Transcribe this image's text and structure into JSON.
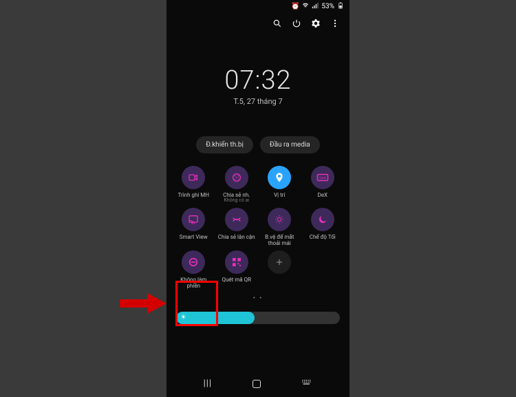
{
  "statusbar": {
    "battery": "53%"
  },
  "toolbar_icons": [
    "search",
    "power",
    "settings",
    "more"
  ],
  "clock": {
    "time": "07:32",
    "date": "T.5, 27 tháng 7"
  },
  "pills": {
    "device_control": "Đ.khiển th.bị",
    "media_output": "Đầu ra media"
  },
  "tiles": [
    {
      "key": "screen-recorder",
      "label": "Trình ghi MH",
      "sub": "",
      "icon": "rec"
    },
    {
      "key": "quick-share",
      "label": "Chia sẻ nh.",
      "sub": "Không có ai",
      "icon": "share"
    },
    {
      "key": "location",
      "label": "Vị trí",
      "sub": "",
      "icon": "pin",
      "on": true
    },
    {
      "key": "dex",
      "label": "DeX",
      "sub": "",
      "icon": "dex"
    },
    {
      "key": "smart-view",
      "label": "Smart View",
      "sub": "",
      "icon": "cast"
    },
    {
      "key": "nearby-share",
      "label": "Chia sẻ lân cận",
      "sub": "",
      "icon": "nearby"
    },
    {
      "key": "eye-comfort",
      "label": "B.vệ để mắt thoải mái",
      "sub": "",
      "icon": "eye"
    },
    {
      "key": "dark-mode",
      "label": "Chế độ Tối",
      "sub": "",
      "icon": "moon"
    },
    {
      "key": "dnd",
      "label": "Không làm phiền",
      "sub": "",
      "icon": "dnd"
    },
    {
      "key": "qr",
      "label": "Quét mã QR",
      "sub": "",
      "icon": "qr"
    },
    {
      "key": "add",
      "label": "",
      "sub": "",
      "icon": "plus",
      "add": true
    }
  ],
  "page_indicator": "• •",
  "brightness_pct": 48,
  "highlight_tile": "dnd"
}
